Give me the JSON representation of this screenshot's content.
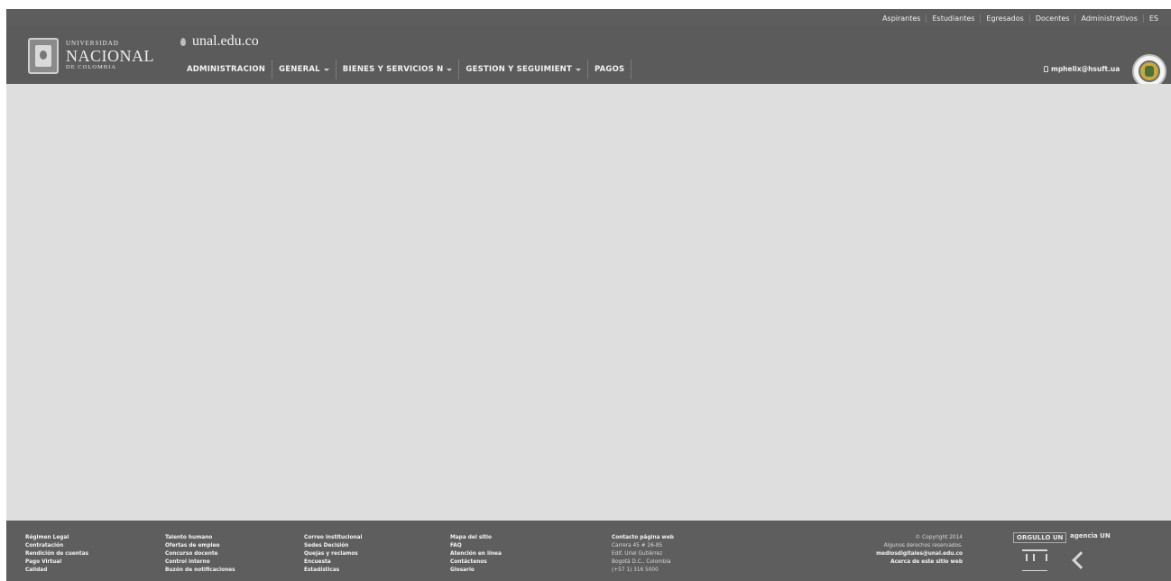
{
  "topbar": {
    "links": [
      "Aspirantes",
      "Estudiantes",
      "Egresados",
      "Docentes",
      "Administrativos",
      "ES"
    ]
  },
  "header": {
    "logo": {
      "line1": "UNIVERSIDAD",
      "line2": "NACIONAL",
      "line3": "DE COLOMBIA"
    },
    "domain": "unal.edu.co",
    "nav": [
      {
        "label": "ADMINISTRACION",
        "dropdown": false
      },
      {
        "label": "GENERAL",
        "dropdown": true
      },
      {
        "label": "BIENES Y SERVICIOS N",
        "dropdown": true
      },
      {
        "label": "GESTION Y SEGUIMIENT",
        "dropdown": true
      },
      {
        "label": "PAGOS",
        "dropdown": false
      }
    ],
    "user": "mphelix@hsuft.ua"
  },
  "footer": {
    "col1": [
      "Régimen Legal",
      "Contratación",
      "Rendición de cuentas",
      "Pago Virtual",
      "Calidad"
    ],
    "col2": [
      "Talento humano",
      "Ofertas de empleo",
      "Concurso docente",
      "Control interno",
      "Buzón de notificaciones"
    ],
    "col3": [
      "Correo institucional",
      "Sedes Decisión",
      "Quejas y reclamos",
      "Encuesta",
      "Estadísticas"
    ],
    "col4": [
      "Mapa del sitio",
      "FAQ",
      "Atención en línea",
      "Contáctenos",
      "Glosario"
    ],
    "col5": [
      "Contacto página web",
      "Carrera 45 # 26-85",
      "Edif. Uriel Gutiérrez",
      "Bogotá D.C., Colombia",
      "(+57 1) 316 5000"
    ],
    "col6": [
      "© Copyright 2014",
      "Algunos derechos reservados.",
      "mediosdigitales@unal.edu.co",
      "Acerca de este sitio web"
    ],
    "logos": {
      "a": "ORGULLO UN",
      "b": "agencia UN"
    }
  }
}
